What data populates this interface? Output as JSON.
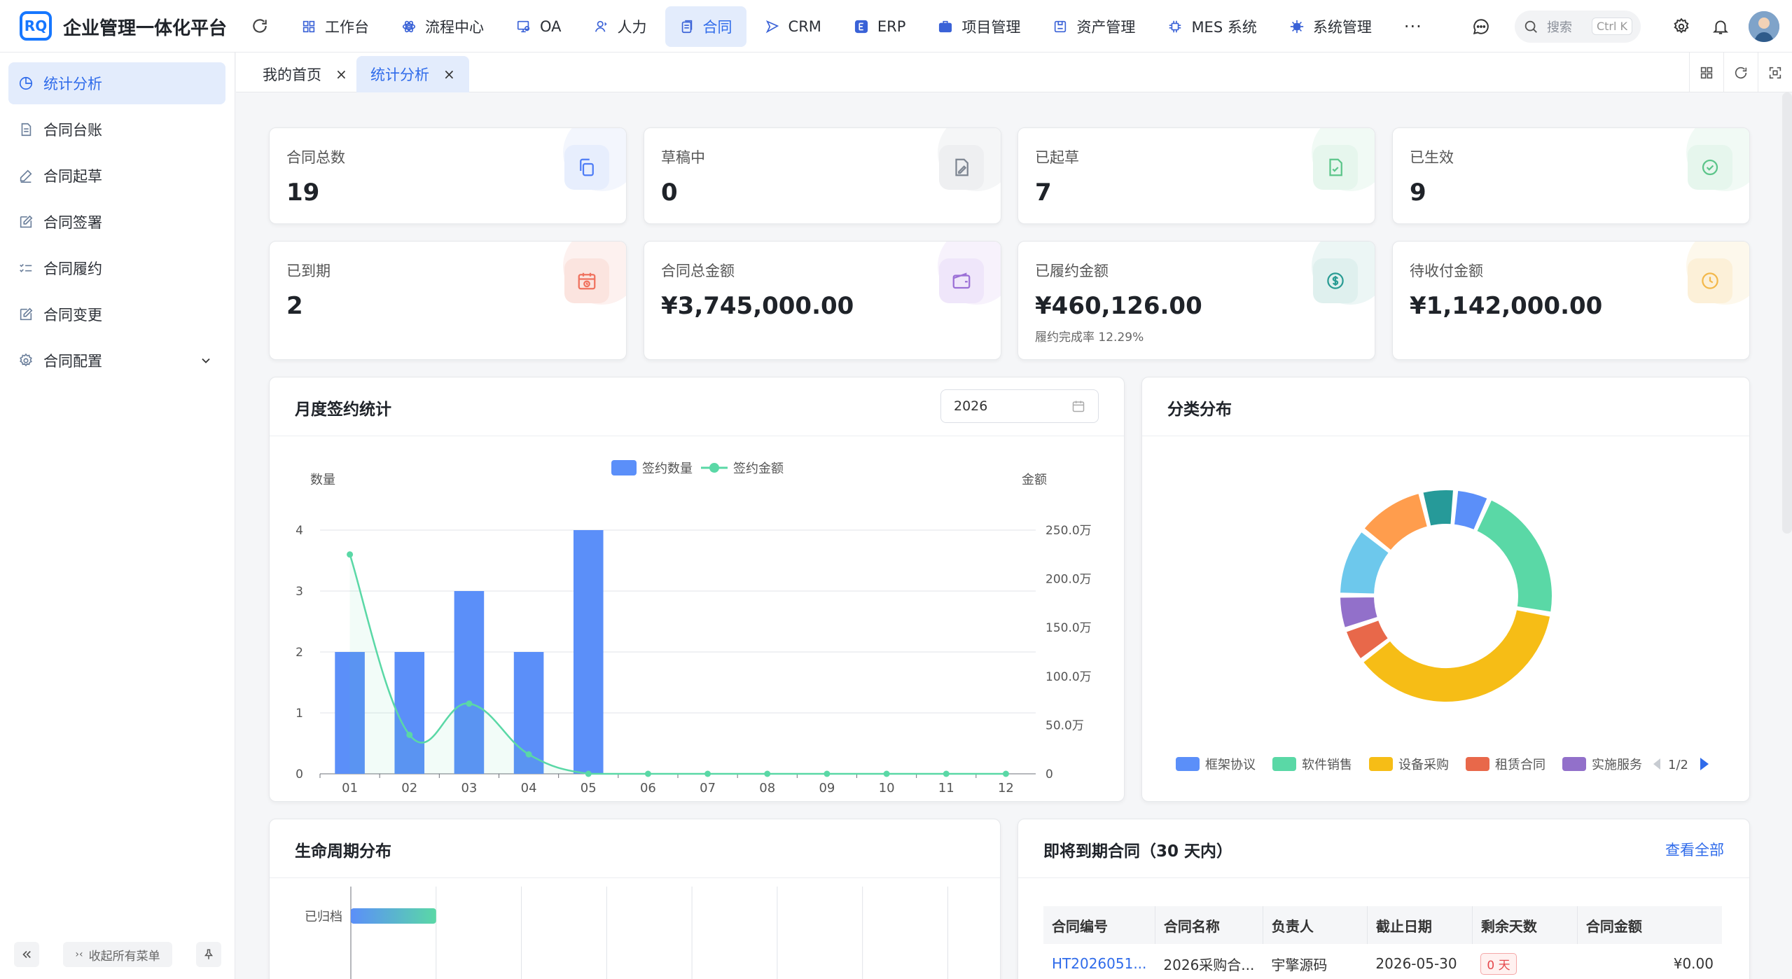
{
  "app": {
    "title": "企业管理一体化平台",
    "logo_text": "RQ"
  },
  "nav": [
    {
      "label": "工作台",
      "icon": "grid-icon"
    },
    {
      "label": "流程中心",
      "icon": "flow-icon"
    },
    {
      "label": "OA",
      "icon": "oa-icon"
    },
    {
      "label": "人力",
      "icon": "user-icon"
    },
    {
      "label": "合同",
      "icon": "contract-icon",
      "active": true
    },
    {
      "label": "CRM",
      "icon": "crm-icon"
    },
    {
      "label": "ERP",
      "icon": "erp-icon"
    },
    {
      "label": "项目管理",
      "icon": "briefcase-icon"
    },
    {
      "label": "资产管理",
      "icon": "asset-icon"
    },
    {
      "label": "MES 系统",
      "icon": "chip-icon"
    },
    {
      "label": "系统管理",
      "icon": "settings-icon"
    }
  ],
  "nav_more": "···",
  "search": {
    "placeholder": "搜索",
    "shortcut": "Ctrl K"
  },
  "sidebar": {
    "items": [
      {
        "label": "统计分析",
        "active": true
      },
      {
        "label": "合同台账"
      },
      {
        "label": "合同起草"
      },
      {
        "label": "合同签署"
      },
      {
        "label": "合同履约"
      },
      {
        "label": "合同变更"
      },
      {
        "label": "合同配置"
      }
    ],
    "collapse_all_label": "收起所有菜单"
  },
  "tabs": [
    {
      "label": "我的首页",
      "close": "×"
    },
    {
      "label": "统计分析",
      "close": "×",
      "active": true
    }
  ],
  "stats": [
    {
      "label": "合同总数",
      "value": "19",
      "color": "#4e7cf6",
      "bg": "#eef2fd"
    },
    {
      "label": "草稿中",
      "value": "0",
      "color": "#7d8591",
      "bg": "#f1f2f4"
    },
    {
      "label": "已起草",
      "value": "7",
      "color": "#5cc58a",
      "bg": "#ecf8f1"
    },
    {
      "label": "已生效",
      "value": "9",
      "color": "#5cc58a",
      "bg": "#ecf8f1"
    },
    {
      "label": "已到期",
      "value": "2",
      "color": "#f0715e",
      "bg": "#fdeeeb"
    },
    {
      "label": "合同总金额",
      "value": "¥3,745,000.00",
      "color": "#9b6fd6",
      "bg": "#f4eefb"
    },
    {
      "label": "已履约金额",
      "value": "¥460,126.00",
      "sub": "履约完成率 12.29%",
      "color": "#2a9c94",
      "bg": "#e6f4f3"
    },
    {
      "label": "待收付金额",
      "value": "¥1,142,000.00",
      "color": "#f3b84a",
      "bg": "#fdf5e6"
    }
  ],
  "monthly": {
    "title": "月度签约统计",
    "year": "2026"
  },
  "category": {
    "title": "分类分布",
    "page": "1/2"
  },
  "lifecycle": {
    "title": "生命周期分布",
    "rows": [
      {
        "label": "已归档",
        "value": 1
      }
    ]
  },
  "expiring": {
    "title": "即将到期合同（30 天内）",
    "view_all": "查看全部",
    "columns": [
      "合同编号",
      "合同名称",
      "负责人",
      "截止日期",
      "剩余天数",
      "合同金额"
    ],
    "rows": [
      {
        "code": "HT2026051...",
        "name": "2026采购合...",
        "owner": "宇擎源码",
        "due": "2026-05-30",
        "days": "0 天",
        "amount": "¥0.00"
      }
    ]
  },
  "chart_data": [
    {
      "type": "bar",
      "categories": [
        "01",
        "02",
        "03",
        "04",
        "05",
        "06",
        "07",
        "08",
        "09",
        "10",
        "11",
        "12"
      ],
      "series": [
        {
          "name": "签约数量",
          "type": "bar",
          "axis": "left",
          "values": [
            2,
            2,
            3,
            2,
            4,
            0,
            0,
            0,
            0,
            0,
            0,
            0
          ],
          "color": "#5b8ff9"
        },
        {
          "name": "签约金额",
          "type": "line",
          "axis": "right",
          "values": [
            2250000,
            400000,
            720000,
            200000,
            0,
            0,
            0,
            0,
            0,
            0,
            0,
            0
          ],
          "color": "#5ad8a6"
        }
      ],
      "ylabel": "数量",
      "ylabel_right": "金额",
      "ylim": [
        0,
        4
      ],
      "yticks": [
        "0",
        "1",
        "2",
        "3",
        "4"
      ],
      "ylim_right": [
        0,
        2500000
      ],
      "yticks_right": [
        "0",
        "50.0万",
        "100.0万",
        "150.0万",
        "200.0万",
        "250.0万"
      ],
      "legend": "top-center",
      "grid": true
    },
    {
      "type": "pie",
      "donut": true,
      "slices": [
        {
          "name": "框架协议",
          "value": 1,
          "color": "#5b8ff9"
        },
        {
          "name": "软件销售",
          "value": 4,
          "color": "#5ad8a6"
        },
        {
          "name": "设备采购",
          "value": 7,
          "color": "#f6bd16"
        },
        {
          "name": "租赁合同",
          "value": 1,
          "color": "#e8684a"
        },
        {
          "name": "实施服务",
          "value": 1,
          "color": "#9270ca"
        },
        {
          "name": "",
          "value": 2,
          "color": "#6dc8ec"
        },
        {
          "name": "",
          "value": 2,
          "color": "#ff9d4d"
        },
        {
          "name": "",
          "value": 1,
          "color": "#269a99"
        }
      ],
      "legend": "bottom"
    }
  ]
}
